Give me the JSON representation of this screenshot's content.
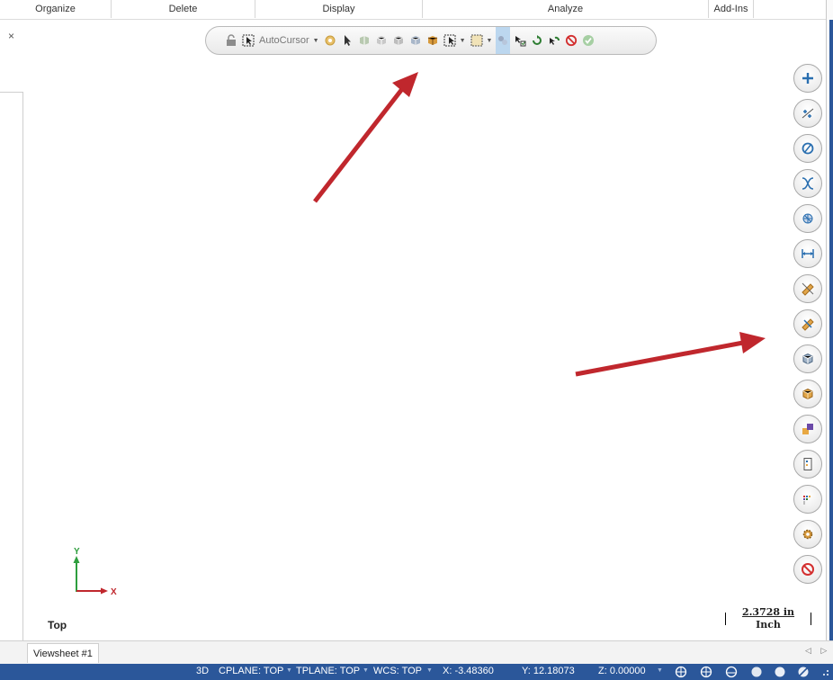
{
  "ribbon": {
    "groups": [
      "Organize",
      "Delete",
      "Display",
      "Analyze",
      "Add-Ins"
    ]
  },
  "panel": {
    "close_glyph": "×"
  },
  "selection_toolbar": {
    "autocursor_label": "AutoCursor",
    "icons": [
      "unlock-icon",
      "select-all-icon",
      "autocursor-icon",
      "gear-icon",
      "pointer-icon",
      "cube-icon",
      "solid-select-icon",
      "face-select-icon",
      "body-select-icon",
      "window-select-icon",
      "verify-icon",
      "move-icon",
      "rotate-icon",
      "undo-icon",
      "clear-icon",
      "ok-icon"
    ]
  },
  "right_toolbar": {
    "buttons": [
      "add-point",
      "point-position",
      "circle",
      "curve",
      "solid",
      "dimension",
      "measure-1",
      "measure-2",
      "cube",
      "box",
      "layer",
      "levels",
      "chart",
      "settings",
      "cancel"
    ]
  },
  "viewport": {
    "axis_y": "Y",
    "axis_x": "X",
    "view_name": "Top",
    "scale_value": "2.3728 in",
    "scale_unit": "Inch"
  },
  "tabs": {
    "viewsheet": "Viewsheet #1",
    "nav": "◁ ▷"
  },
  "status": {
    "mode": "3D",
    "cplane": "CPLANE: TOP",
    "tplane": "TPLANE: TOP",
    "wcs": "WCS: TOP",
    "x": "X:  -3.48360",
    "y": "Y:  12.18073",
    "z": "Z:  0.00000"
  },
  "colors": {
    "accent": "#2b579a",
    "arrow": "#c0272d",
    "axis_y": "#2e9e3e",
    "axis_x": "#c0272d"
  }
}
